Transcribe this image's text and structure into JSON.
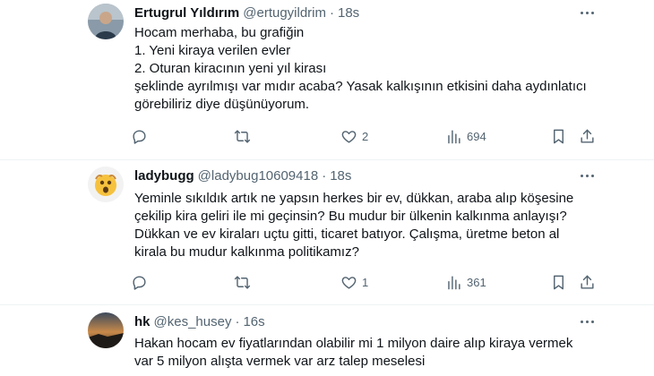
{
  "tweets": [
    {
      "name": "Ertugrul Yıldırım",
      "handle": "@ertugyildrim",
      "separator": "·",
      "time": "18s",
      "lines": [
        "Hocam merhaba, bu grafiğin",
        "1. Yeni kiraya verilen evler",
        "2. Oturan kiracının yeni yıl kirası",
        "şeklinde ayrılmışı var mıdır acaba? Yasak kalkışının etkisini daha aydınlatıcı",
        "görebiliriz diye düşünüyorum."
      ],
      "reply_count": "",
      "retweet_count": "",
      "like_count": "2",
      "view_count": "694"
    },
    {
      "name": "ladybugg",
      "handle": "@ladybug10609418",
      "separator": "·",
      "time": "18s",
      "lines": [
        "Yeminle sıkıldık artık ne yapsın herkes bir ev, dükkan, araba alıp köşesine",
        "çekilip kira geliri ile mi geçinsin? Bu mudur bir ülkenin kalkınma anlayışı?",
        "Dükkan ve ev kiraları uçtu gitti, ticaret batıyor. Çalışma, üretme beton al",
        "kirala bu mudur kalkınma politikamız?"
      ],
      "reply_count": "",
      "retweet_count": "",
      "like_count": "1",
      "view_count": "361"
    },
    {
      "name": "hk",
      "handle": "@kes_husey",
      "separator": "·",
      "time": "16s",
      "lines": [
        "Hakan hocam ev fiyatlarından olabilir mi 1 milyon daire alıp kiraya vermek",
        "var 5 milyon alışta vermek var arz talep meselesi"
      ]
    }
  ],
  "colors": {
    "text": "#0f1419",
    "muted": "#536471",
    "divider": "#eff3f4"
  },
  "icons": [
    "reply-icon",
    "retweet-icon",
    "like-icon",
    "views-icon",
    "bookmark-icon",
    "share-icon",
    "more-icon"
  ]
}
